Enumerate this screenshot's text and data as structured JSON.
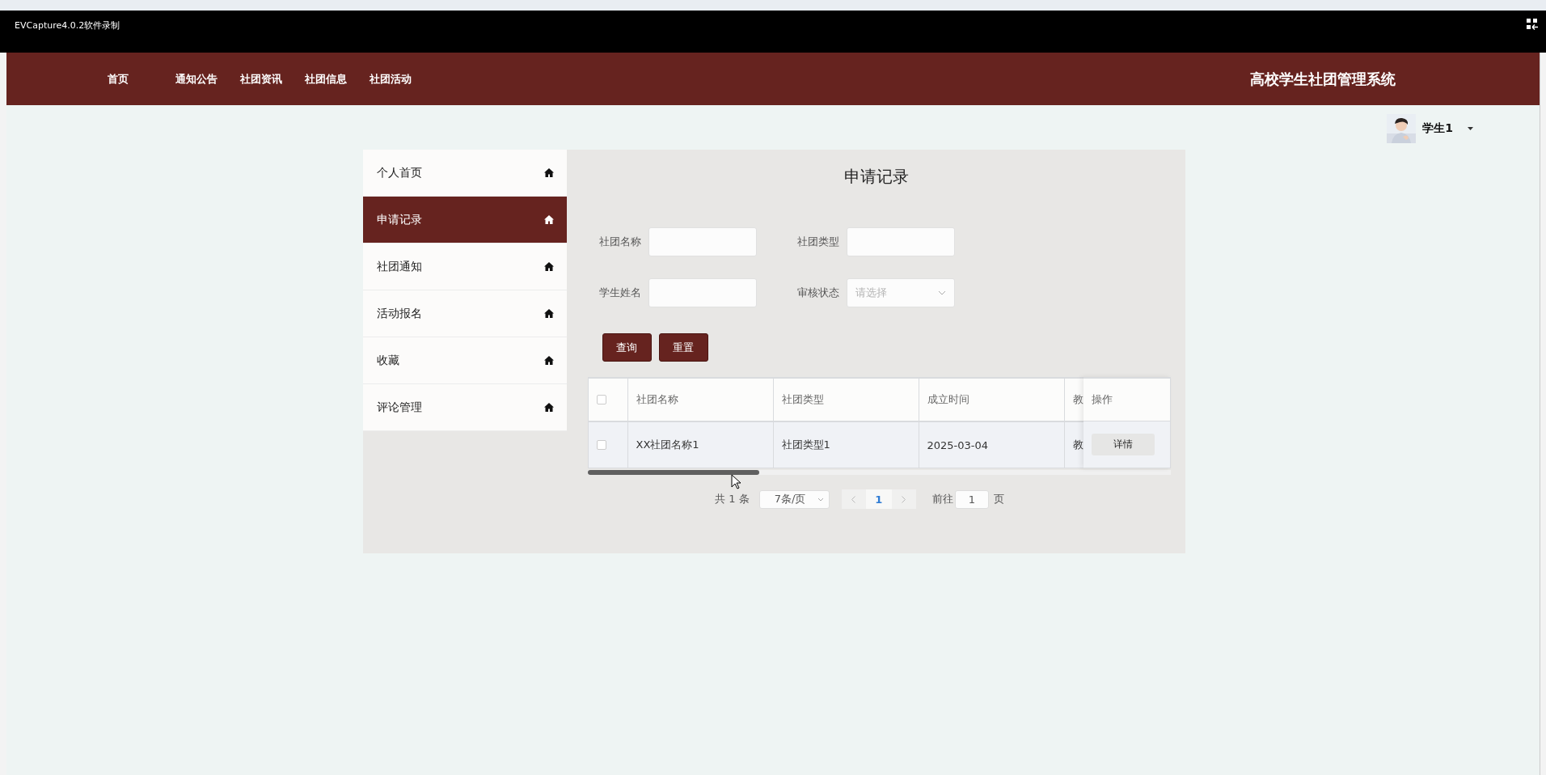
{
  "recorder_bar": {
    "title": "EVCapture4.0.2软件录制"
  },
  "nav": {
    "items": [
      {
        "label": "首页"
      },
      {
        "label": "通知公告"
      },
      {
        "label": "社团资讯"
      },
      {
        "label": "社团信息"
      },
      {
        "label": "社团活动"
      }
    ],
    "title": "高校学生社团管理系统"
  },
  "user": {
    "name": "学生1"
  },
  "sidebar": {
    "items": [
      {
        "label": "个人首页",
        "selected": false
      },
      {
        "label": "申请记录",
        "selected": true
      },
      {
        "label": "社团通知",
        "selected": false
      },
      {
        "label": "活动报名",
        "selected": false
      },
      {
        "label": "收藏",
        "selected": false
      },
      {
        "label": "评论管理",
        "selected": false
      }
    ]
  },
  "page_title": "申请记录",
  "filters": [
    {
      "label": "社团名称",
      "kind": "text"
    },
    {
      "label": "社团类型",
      "kind": "text"
    },
    {
      "label": "学生姓名",
      "kind": "text"
    },
    {
      "label": "审核状态",
      "kind": "select",
      "placeholder": "请选择"
    }
  ],
  "buttons": [
    "查询",
    "重置"
  ],
  "table": {
    "header_checked": false,
    "columns": [
      "社团名称",
      "社团类型",
      "成立时间",
      "教"
    ],
    "action_column": "操作",
    "rows": [
      {
        "checked": false,
        "cells": [
          "XX社团名称1",
          "社团类型1",
          "2025-03-04",
          "教"
        ],
        "action": "详情"
      }
    ]
  },
  "pagination": {
    "total": "共 1 条",
    "page_size": "7条/页",
    "pages": [
      {
        "label": "1",
        "selected": true
      }
    ],
    "goto_label": "前往",
    "goto_value": "1",
    "page_unit": "页"
  }
}
